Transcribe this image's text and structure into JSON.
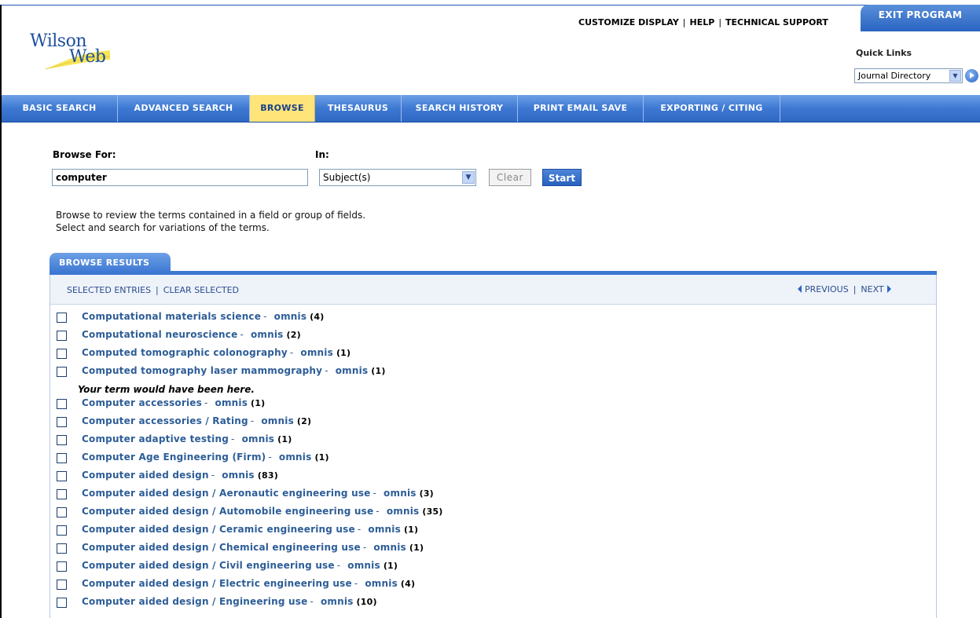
{
  "header": {
    "logo_line1": "Wilson",
    "logo_line2": "Web",
    "links": [
      "CUSTOMIZE DISPLAY",
      "HELP",
      "TECHNICAL SUPPORT"
    ],
    "exit_label": "EXIT PROGRAM",
    "quick_links_label": "Quick Links",
    "quick_links_value": "Journal Directory"
  },
  "nav": {
    "tabs": [
      "BASIC SEARCH",
      "ADVANCED SEARCH",
      "BROWSE",
      "THESAURUS",
      "SEARCH HISTORY",
      "PRINT EMAIL SAVE",
      "EXPORTING / CITING"
    ],
    "active": "BROWSE"
  },
  "form": {
    "browse_for_label": "Browse For:",
    "browse_for_value": "computer",
    "in_label": "In:",
    "in_value": "Subject(s)",
    "clear_label": "Clear",
    "start_label": "Start",
    "desc_line1": "Browse to review the terms contained in a field or group of fields.",
    "desc_line2": "Select and search for variations of the terms."
  },
  "results": {
    "tab_label": "BROWSE RESULTS",
    "selected_entries": "SELECTED ENTRIES",
    "clear_selected": "CLEAR SELECTED",
    "previous": "PREVIOUS",
    "next": "NEXT",
    "note": "Your term would have been here.",
    "items_before": [
      {
        "term": "Computational materials science",
        "db": "omnis",
        "count": "(4)"
      },
      {
        "term": "Computational neuroscience",
        "db": "omnis",
        "count": "(2)"
      },
      {
        "term": "Computed tomographic colonography",
        "db": "omnis",
        "count": "(1)"
      },
      {
        "term": "Computed tomography laser mammography",
        "db": "omnis",
        "count": "(1)"
      }
    ],
    "items_after": [
      {
        "term": "Computer accessories",
        "db": "omnis",
        "count": "(1)"
      },
      {
        "term": "Computer accessories / Rating",
        "db": "omnis",
        "count": "(2)"
      },
      {
        "term": "Computer adaptive testing",
        "db": "omnis",
        "count": "(1)"
      },
      {
        "term": "Computer Age Engineering (Firm)",
        "db": "omnis",
        "count": "(1)"
      },
      {
        "term": "Computer aided design",
        "db": "omnis",
        "count": "(83)"
      },
      {
        "term": "Computer aided design / Aeronautic engineering use",
        "db": "omnis",
        "count": "(3)"
      },
      {
        "term": "Computer aided design / Automobile engineering use",
        "db": "omnis",
        "count": "(35)"
      },
      {
        "term": "Computer aided design / Ceramic engineering use",
        "db": "omnis",
        "count": "(1)"
      },
      {
        "term": "Computer aided design / Chemical engineering use",
        "db": "omnis",
        "count": "(1)"
      },
      {
        "term": "Computer aided design / Civil engineering use",
        "db": "omnis",
        "count": "(1)"
      },
      {
        "term": "Computer aided design / Electric engineering use",
        "db": "omnis",
        "count": "(4)"
      },
      {
        "term": "Computer aided design / Engineering use",
        "db": "omnis",
        "count": "(10)"
      }
    ]
  }
}
